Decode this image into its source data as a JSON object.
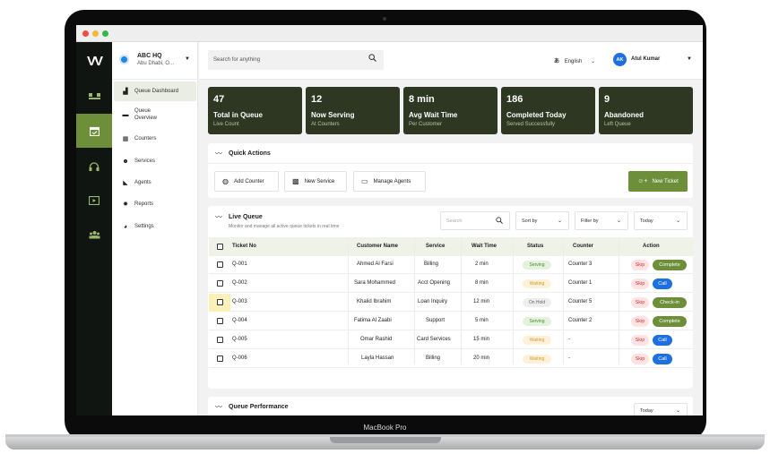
{
  "device": {
    "model": "MacBook Pro"
  },
  "colors": {
    "accent": "#6d8f3a",
    "dark_card": "#2d3722",
    "rail": "#111511",
    "user_avatar": "#1e6fe0"
  },
  "org": {
    "name": "ABC HQ",
    "location": "Abu Dhabi, O..."
  },
  "sidebar": {
    "items": [
      {
        "label": "Queue Dashboard",
        "icon": "bar-chart-icon"
      },
      {
        "label": "Queue Overview",
        "icon": "folder-icon"
      },
      {
        "label": "Counters",
        "icon": "calendar-icon"
      },
      {
        "label": "Services",
        "icon": "users-plus-icon"
      },
      {
        "label": "Agents",
        "icon": "megaphone-icon"
      },
      {
        "label": "Reports",
        "icon": "gear-icon"
      },
      {
        "label": "Settings",
        "icon": "settings-icon"
      }
    ]
  },
  "header": {
    "search_placeholder": "Search for anything",
    "language": "English",
    "user": {
      "initials": "AK",
      "name": "Atul Kumar"
    }
  },
  "stats": [
    {
      "value": "47",
      "label": "Total in Queue",
      "sub": "Live Count"
    },
    {
      "value": "12",
      "label": "Now Serving",
      "sub": "At Counters"
    },
    {
      "value": "8 min",
      "label": "Avg Wait Time",
      "sub": "Per Customer"
    },
    {
      "value": "186",
      "label": "Completed Today",
      "sub": "Served Successfully"
    },
    {
      "value": "9",
      "label": "Abandoned",
      "sub": "Left Queue"
    }
  ],
  "quick_actions": {
    "title": "Quick Actions",
    "buttons": [
      "Add Counter",
      "New Service",
      "Manage Agents"
    ],
    "new_ticket": "New Ticket"
  },
  "live_queue": {
    "title": "Live Queue",
    "subtitle": "Monitor and manage all active queue tickets in real time",
    "search_placeholder": "Search",
    "sort": "Sort by",
    "filter": "Filter by",
    "range": "Today",
    "columns": [
      "Ticket No",
      "Customer Name",
      "Service",
      "Wait Time",
      "Status",
      "Counter",
      "Action"
    ],
    "rows": [
      {
        "ticket": "Q-001",
        "customer": "Ahmed Al Farsi",
        "service": "Billing",
        "wait": "2 min",
        "status": "Serving",
        "counter": "Counter 3",
        "skip": "Skip",
        "action": "Complete"
      },
      {
        "ticket": "Q-002",
        "customer": "Sara Mohammed",
        "service": "Acct Opening",
        "wait": "8 min",
        "status": "Waiting",
        "counter": "Counter 1",
        "skip": "Skip",
        "action": "Call"
      },
      {
        "ticket": "Q-003",
        "customer": "Khalid Ibrahim",
        "service": "Loan Inquiry",
        "wait": "12 min",
        "status": "On Hold",
        "counter": "Counter 5",
        "skip": "Skip",
        "action": "Check-in"
      },
      {
        "ticket": "Q-004",
        "customer": "Fatima Al Zaabi",
        "service": "Support",
        "wait": "5 min",
        "status": "Serving",
        "counter": "Counter 2",
        "skip": "Skip",
        "action": "Complete"
      },
      {
        "ticket": "Q-005",
        "customer": "Omar Rashid",
        "service": "Card Services",
        "wait": "15 min",
        "status": "Waiting",
        "counter": "-",
        "skip": "Skip",
        "action": "Call"
      },
      {
        "ticket": "Q-006",
        "customer": "Layla Hassan",
        "service": "Billing",
        "wait": "20 min",
        "status": "Waiting",
        "counter": "-",
        "skip": "Skip",
        "action": "Call"
      }
    ]
  },
  "performance": {
    "title": "Queue Performance",
    "range": "Today"
  }
}
